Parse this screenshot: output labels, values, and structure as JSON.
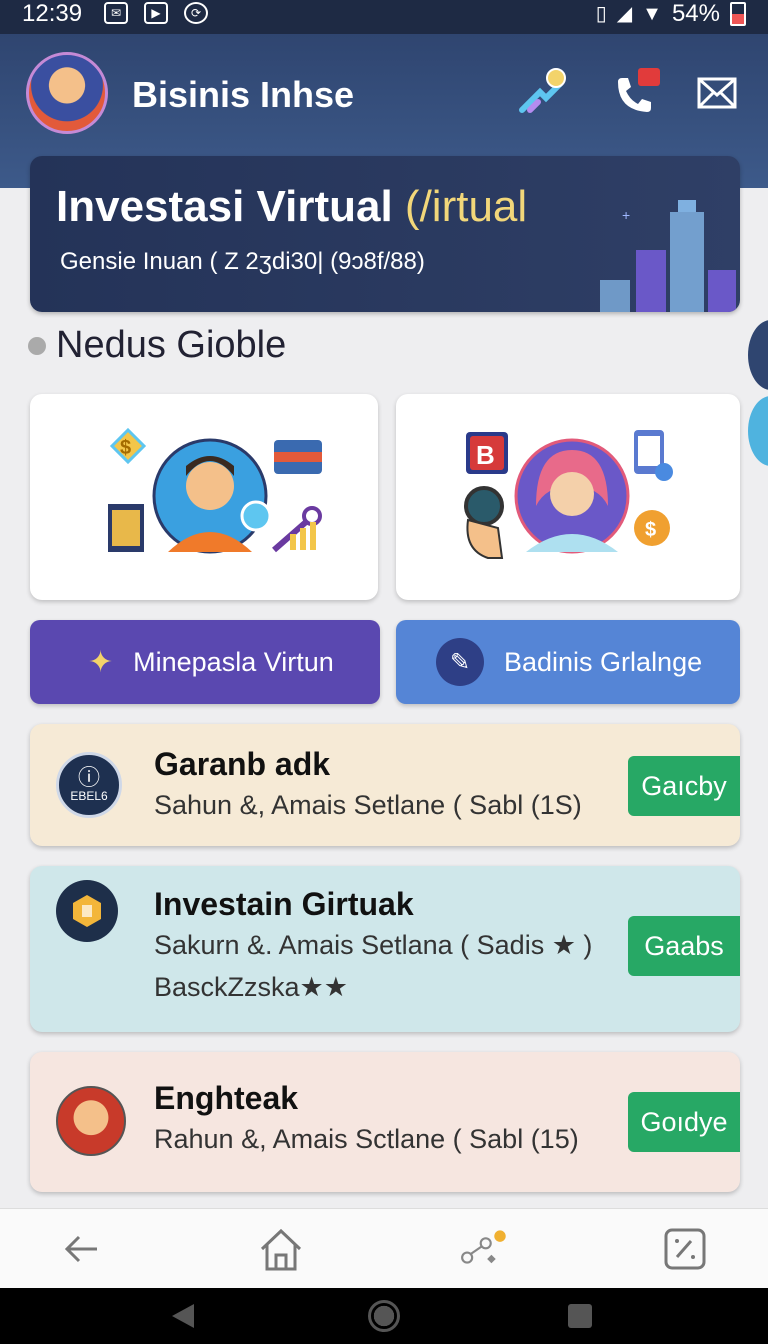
{
  "status": {
    "time": "12:39",
    "battery": "54%"
  },
  "header": {
    "title": "Bisinis Inhse"
  },
  "banner": {
    "title": "Investasi Virtual",
    "title_accent": "(/irtual",
    "subtitle": "Gensie Inuan ( Z 2ʒdi30| (9ɔ8f/88)"
  },
  "section": {
    "title": "Nedus Gioble"
  },
  "tiles": [
    {
      "label": "Minepasla Virtun",
      "color": "#5a48b0"
    },
    {
      "label": "Badinis Grlalnge",
      "color": "#5585d6"
    }
  ],
  "list": [
    {
      "title": "Garanb adk",
      "subtitle": "Sahun &, Amais Setlane ( Sabl (1S)",
      "button": "Gaıcby",
      "icon_text": "EBEL6",
      "bg": "#f6ead6"
    },
    {
      "title": "Investain Girtuak",
      "subtitle": "Sakurn &. Amais Setlana ( Sadis ★ )",
      "subtitle2": "BasckZzska★★",
      "button": "Gaabs",
      "bg": "#cfe7ea"
    },
    {
      "title": "Enghteak",
      "subtitle": "Rahun &, Amais Sctlane ( Sabl (15)",
      "button": "Goıdye",
      "bg": "#f6e6e0"
    }
  ],
  "icons": {
    "header": [
      "lightbulb-tree-icon",
      "phone-notification-icon",
      "mail-icon"
    ],
    "nav": [
      "back-arrow-icon",
      "home-icon",
      "share-coin-icon",
      "edit-square-icon"
    ]
  },
  "colors": {
    "header": "#34507d",
    "banner": "#243358",
    "accent": "#f2d77a",
    "button_green": "#27a865"
  }
}
